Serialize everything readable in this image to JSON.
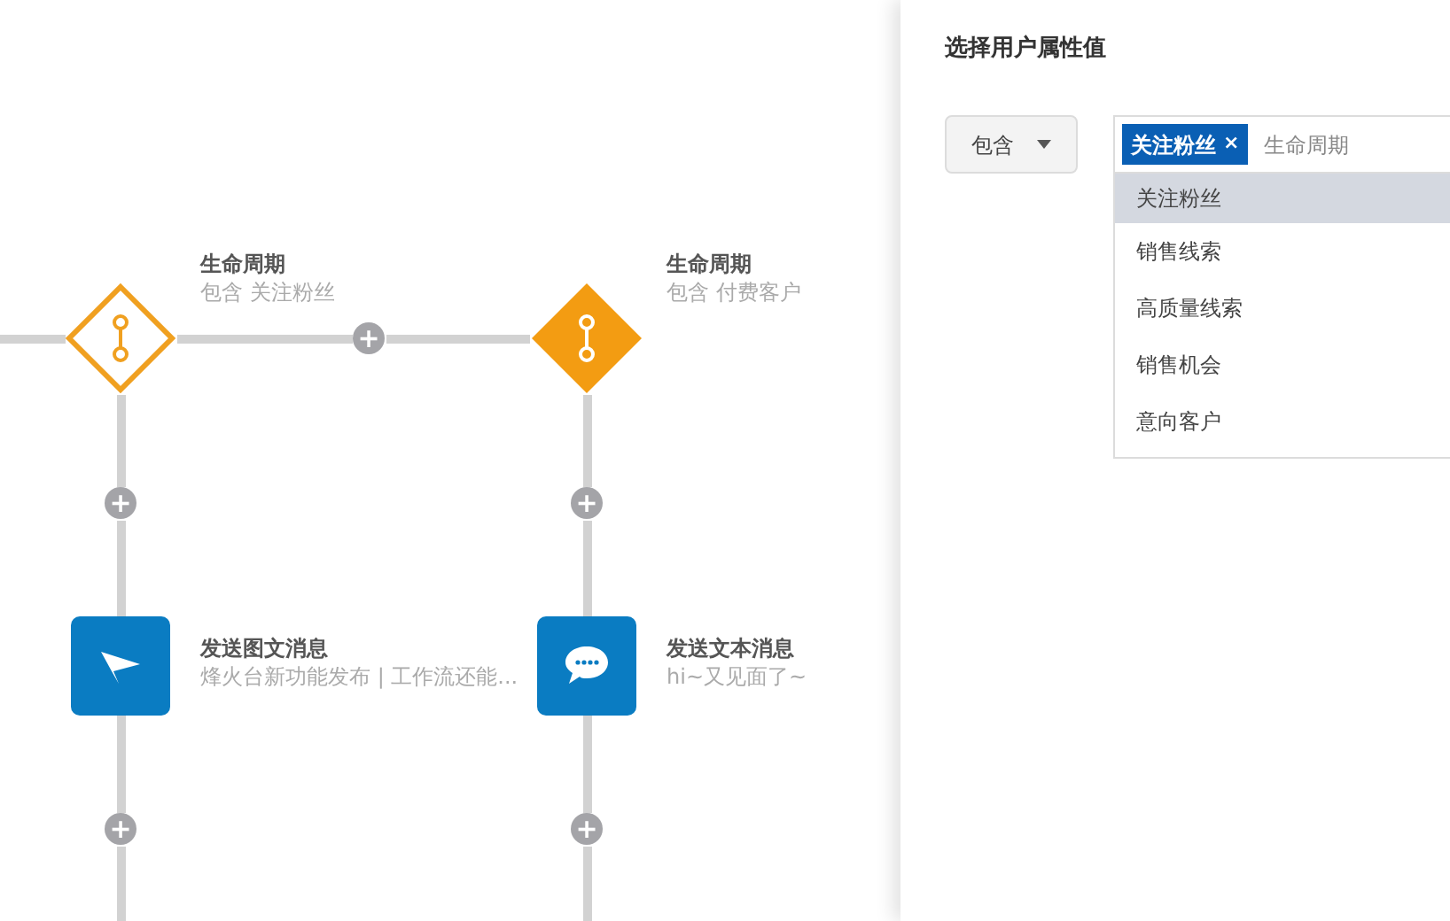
{
  "flow": {
    "nodes": [
      {
        "kind": "condition",
        "selected": true,
        "title": "生命周期",
        "subtitle": "包含 关注粉丝"
      },
      {
        "kind": "condition",
        "selected": false,
        "title": "生命周期",
        "subtitle": "包含 付费客户"
      },
      {
        "kind": "news",
        "title": "发送图文消息",
        "subtitle": "烽火台新功能发布 | 工作流还能..."
      },
      {
        "kind": "text",
        "title": "发送文本消息",
        "subtitle": "hi~又见面了~"
      }
    ],
    "add_label": "+"
  },
  "panel": {
    "title": "选择用户属性值",
    "operator": "包含",
    "tags": [
      {
        "label": "关注粉丝",
        "remove": "×"
      }
    ],
    "placeholder": "生命周期",
    "options": [
      {
        "label": "关注粉丝",
        "selected": true
      },
      {
        "label": "销售线索",
        "selected": false
      },
      {
        "label": "高质量线索",
        "selected": false
      },
      {
        "label": "销售机会",
        "selected": false
      },
      {
        "label": "意向客户",
        "selected": false
      }
    ]
  }
}
